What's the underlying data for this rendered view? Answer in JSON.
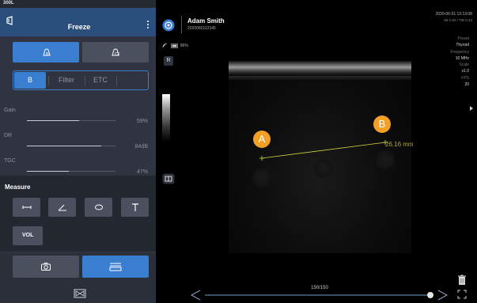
{
  "left_panel": {
    "probe_label": "300L",
    "title": "Freeze",
    "mode_buttons": [
      {
        "icon": "b-mode-probe-icon",
        "active": true
      },
      {
        "icon": "cf-mode-probe-icon",
        "active": false
      }
    ],
    "tabs": [
      "B",
      "Filter",
      "ETC"
    ],
    "params": [
      {
        "label": "Gain",
        "value": "59%",
        "level": 0.59
      },
      {
        "label": "DR",
        "value": "84dB",
        "level": 0.84
      },
      {
        "label": "TGC",
        "value": "47%",
        "level": 0.47
      }
    ],
    "measure": {
      "title": "Measure",
      "tools": [
        "distance-tool-icon",
        "angle-tool-icon",
        "ellipse-tool-icon",
        "text-tool-icon"
      ],
      "vol_label": "VOL"
    },
    "bottom_buttons": [
      {
        "icon": "camera-icon",
        "active": false
      },
      {
        "icon": "cine-clip-icon",
        "active": true
      }
    ]
  },
  "patient": {
    "name": "Adam Smith",
    "id": "2020060112345",
    "datetime": "2020-06-01 13:13:08",
    "mi_tib": "MI 0.82 / TIB 0.33"
  },
  "status": {
    "battery": "96%",
    "orientation": "R"
  },
  "preset_panel": [
    {
      "label": "Preset",
      "value": "Thyroid"
    },
    {
      "label": "Frequency",
      "value": "10 MHz"
    },
    {
      "label": "Scale",
      "value": "x1.0"
    },
    {
      "label": "FPS",
      "value": "20"
    }
  ],
  "measurement": {
    "marker_a": "A",
    "marker_b": "B",
    "value": "26.16 mm"
  },
  "cine": {
    "progress_label": "150/150",
    "progress": 1.0
  },
  "colors": {
    "accent": "#3a7ecf",
    "marker": "#f2a126",
    "measure_line": "#d5d53a"
  }
}
